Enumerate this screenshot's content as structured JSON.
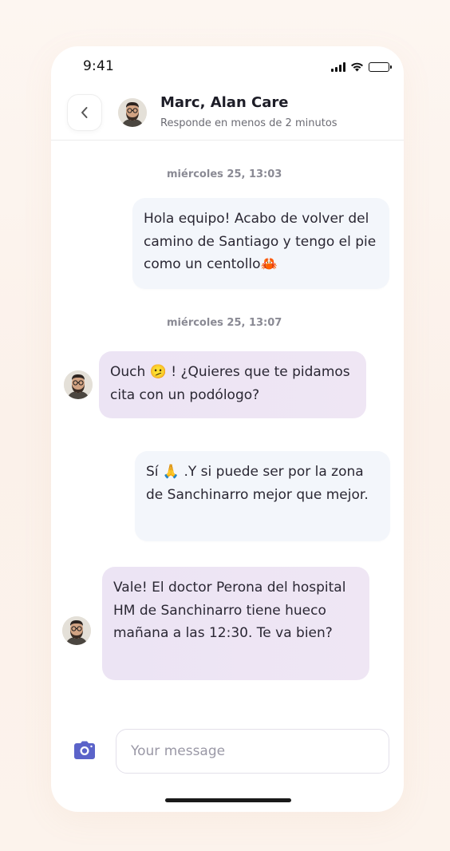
{
  "status_bar": {
    "time": "9:41"
  },
  "header": {
    "contact_name": "Marc, Alan Care",
    "subtitle": "Responde en menos de 2 minutos"
  },
  "messages": [
    {
      "type": "date",
      "text": "miércoles 25, 13:03"
    },
    {
      "type": "outgoing",
      "text": "Hola equipo! Acabo de volver del camino de Santiago y tengo el pie como un centollo🦀"
    },
    {
      "type": "date",
      "text": "miércoles 25, 13:07"
    },
    {
      "type": "incoming",
      "text": "Ouch 🫤 ! ¿Quieres que te pidamos cita con un podólogo?"
    },
    {
      "type": "outgoing",
      "text": "Sí 🙏 .Y si puede ser por la zona de Sanchinarro mejor que mejor."
    },
    {
      "type": "incoming",
      "text": "Vale! El doctor Perona del hospital HM de Sanchinarro tiene hueco mañana a las 12:30. Te va bien?"
    }
  ],
  "composer": {
    "placeholder": "Your message"
  },
  "colors": {
    "accent": "#5b63c9",
    "incoming_bubble": "#ede4f4",
    "outgoing_bubble": "#f3f6fb"
  }
}
